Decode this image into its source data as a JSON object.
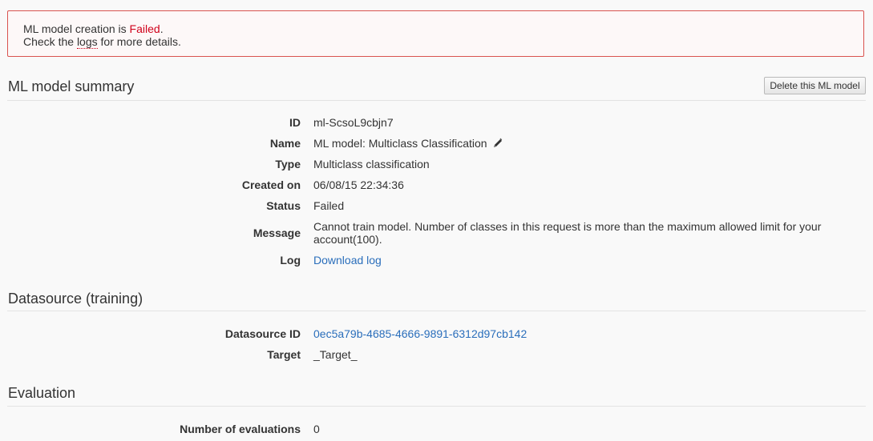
{
  "alert": {
    "line1_prefix": "ML model creation is ",
    "line1_status": "Failed",
    "line1_suffix": ".",
    "line2_prefix": "Check the ",
    "line2_link": "logs",
    "line2_suffix": " for more details."
  },
  "summary": {
    "title": "ML model summary",
    "delete_button": "Delete this ML model",
    "rows": {
      "id": {
        "label": "ID",
        "value": "ml-ScsoL9cbjn7"
      },
      "name": {
        "label": "Name",
        "value": "ML model: Multiclass Classification",
        "icon": "pencil-icon"
      },
      "type": {
        "label": "Type",
        "value": "Multiclass classification"
      },
      "created": {
        "label": "Created on",
        "value": "06/08/15 22:34:36"
      },
      "status": {
        "label": "Status",
        "value": "Failed"
      },
      "message": {
        "label": "Message",
        "value": "Cannot train model. Number of classes in this request is more than the maximum allowed limit for your account(100)."
      },
      "log": {
        "label": "Log",
        "value": "Download log"
      }
    }
  },
  "datasource": {
    "title": "Datasource (training)",
    "rows": {
      "id": {
        "label": "Datasource ID",
        "value": "0ec5a79b-4685-4666-9891-6312d97cb142"
      },
      "target": {
        "label": "Target",
        "value": "_Target_"
      }
    }
  },
  "evaluation": {
    "title": "Evaluation",
    "rows": {
      "count": {
        "label": "Number of evaluations",
        "value": "0"
      }
    }
  },
  "colors": {
    "error": "#d0021b",
    "link": "#2a6ebb",
    "alert_border": "#d9534f"
  }
}
